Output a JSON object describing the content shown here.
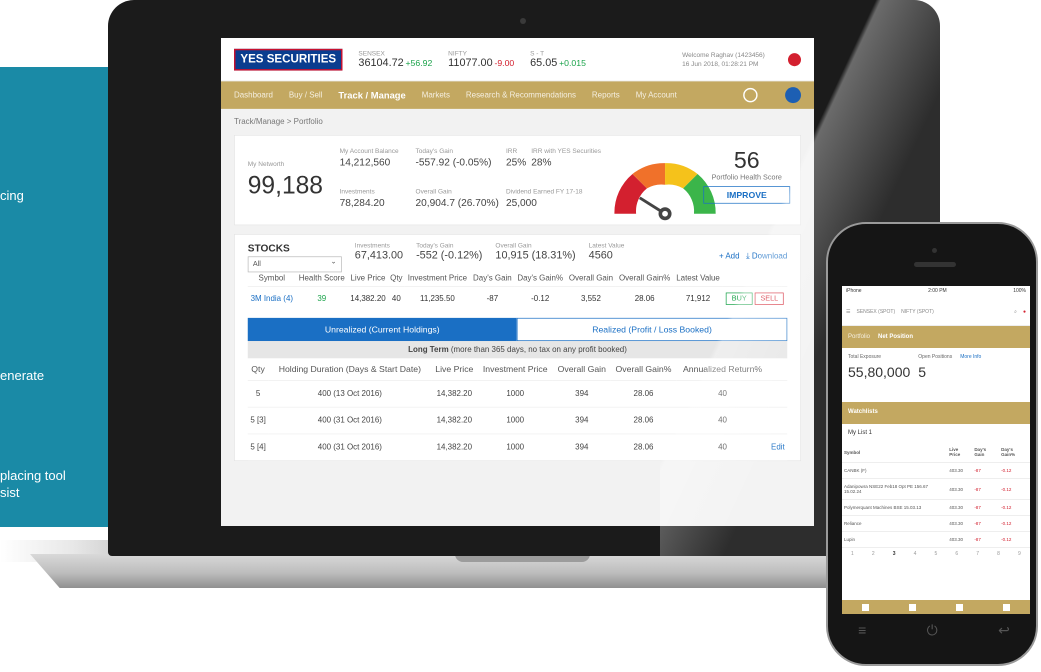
{
  "sidebar": {
    "frag1": "cing",
    "frag2": "enerate",
    "frag3": " placing tool",
    "frag4": "sist"
  },
  "header": {
    "logo": "YES SECURITIES",
    "sensex_label": "SENSEX",
    "sensex_value": "36104.72",
    "sensex_change": "+56.92",
    "nifty_label": "NIFTY",
    "nifty_value": "11077.00",
    "nifty_change": "-9.00",
    "stock_label": "S - T",
    "stock_value": "65.05",
    "stock_change": "+0.015",
    "welcome": "Welcome Raghav (1423456)",
    "timestamp": "16 Jun 2018, 01:28:21 PM"
  },
  "nav": {
    "items": [
      "Dashboard",
      "Buy / Sell",
      "Track / Manage",
      "Markets",
      "Research & Recommendations",
      "Reports",
      "My Account"
    ]
  },
  "breadcrumb": "Track/Manage > Portfolio",
  "networth": {
    "label": "My Networth",
    "value": "99,188",
    "balance_label": "My Account Balance",
    "balance": "14,212,560",
    "todays_gain_label": "Today's Gain",
    "todays_gain": "-557.92 (-0.05%)",
    "irr_label": "IRR",
    "irr": "25%",
    "irr2_label": "IRR with YES Securities",
    "irr2": "28%",
    "investments_label": "Investments",
    "investments": "78,284.20",
    "overall_gain_label": "Overall Gain",
    "overall_gain": "20,904.7 (26.70%)",
    "dividend_label": "Dividend Earned FY 17-18",
    "dividend": "25,000"
  },
  "health": {
    "score": "56",
    "label": "Portfolio Health Score",
    "button": "IMPROVE"
  },
  "stocks": {
    "title": "STOCKS",
    "filter": "All",
    "inv_label": "Investments",
    "inv": "67,413.00",
    "tg_label": "Today's Gain",
    "tg": "-552 (-0.12%)",
    "og_label": "Overall Gain",
    "og": "10,915 (18.31%)",
    "lv_label": "Latest Value",
    "lv": "4560",
    "add": "+ Add",
    "download": "⤓ Download",
    "headers": [
      "Symbol",
      "Health Score",
      "Live Price",
      "Qty",
      "Investment Price",
      "Day's Gain",
      "Day's Gain%",
      "Overall Gain",
      "Overall Gain%",
      "Latest Value"
    ],
    "row": {
      "symbol": "3M India (4)",
      "score": "39",
      "live": "14,382.20",
      "qty": "40",
      "inv": "11,235.50",
      "dg": "-87",
      "dgp": "-0.12",
      "og": "3,552",
      "ogp": "28.06",
      "lv": "71,912",
      "buy": "BUY",
      "sell": "SELL"
    }
  },
  "holdings": {
    "tab1": "Unrealized (Current Holdings)",
    "tab2": "Realized (Profit / Loss Booked)",
    "longterm_bold": "Long Term",
    "longterm_rest": " (more than 365 days, no tax on any profit booked)",
    "headers": [
      "Qty",
      "Holding Duration (Days & Start Date)",
      "Live Price",
      "Investment Price",
      "Overall Gain",
      "Overall Gain%",
      "Annualized Return%"
    ],
    "rows": [
      {
        "qty": "5",
        "dur": "400 (13 Oct 2016)",
        "live": "14,382.20",
        "inv": "1000",
        "og": "394",
        "ogp": "28.06",
        "ar": "40"
      },
      {
        "qty": "5 [3]",
        "dur": "400 (31 Oct 2016)",
        "live": "14,382.20",
        "inv": "1000",
        "og": "394",
        "ogp": "28.06",
        "ar": "40"
      },
      {
        "qty": "5 [4]",
        "dur": "400 (31 Oct 2016)",
        "live": "14,382.20",
        "inv": "1000",
        "og": "394",
        "ogp": "28.06",
        "ar": "40"
      }
    ],
    "edit": "Edit"
  },
  "phone": {
    "carrier": "iPhone",
    "time": "2:00 PM",
    "battery": "100%",
    "sensex": "SENSEX (SPOT)",
    "nifty": "NIFTY (SPOT)",
    "tab1": "Portfolio",
    "tab2": "Net Position",
    "exp_label": "Total Exposure",
    "exp": "55,80,000",
    "open_label": "Open Positions",
    "open": "5",
    "more": "More Info",
    "watchlists": "Watchlists",
    "list": "My List 1",
    "cols": [
      "Symbol",
      "Live Price",
      "Day's Gain",
      "Day's Gain%"
    ],
    "rows": [
      [
        "CANBK (F)",
        "403.30",
        "-87",
        "-0.12"
      ],
      [
        "Adanipowra NSE22 Feb18 Opt PE 156.67 15.02.24",
        "403.30",
        "-87",
        "-0.12"
      ],
      [
        "Polymerquant Machines BSE 15.03.13",
        "403.30",
        "-87",
        "-0.12"
      ],
      [
        "Reliance",
        "403.30",
        "-87",
        "-0.12"
      ],
      [
        "Lupin",
        "403.30",
        "-87",
        "-0.12"
      ]
    ],
    "pages": [
      "1",
      "2",
      "3",
      "4",
      "5",
      "6",
      "7",
      "8",
      "9"
    ]
  }
}
